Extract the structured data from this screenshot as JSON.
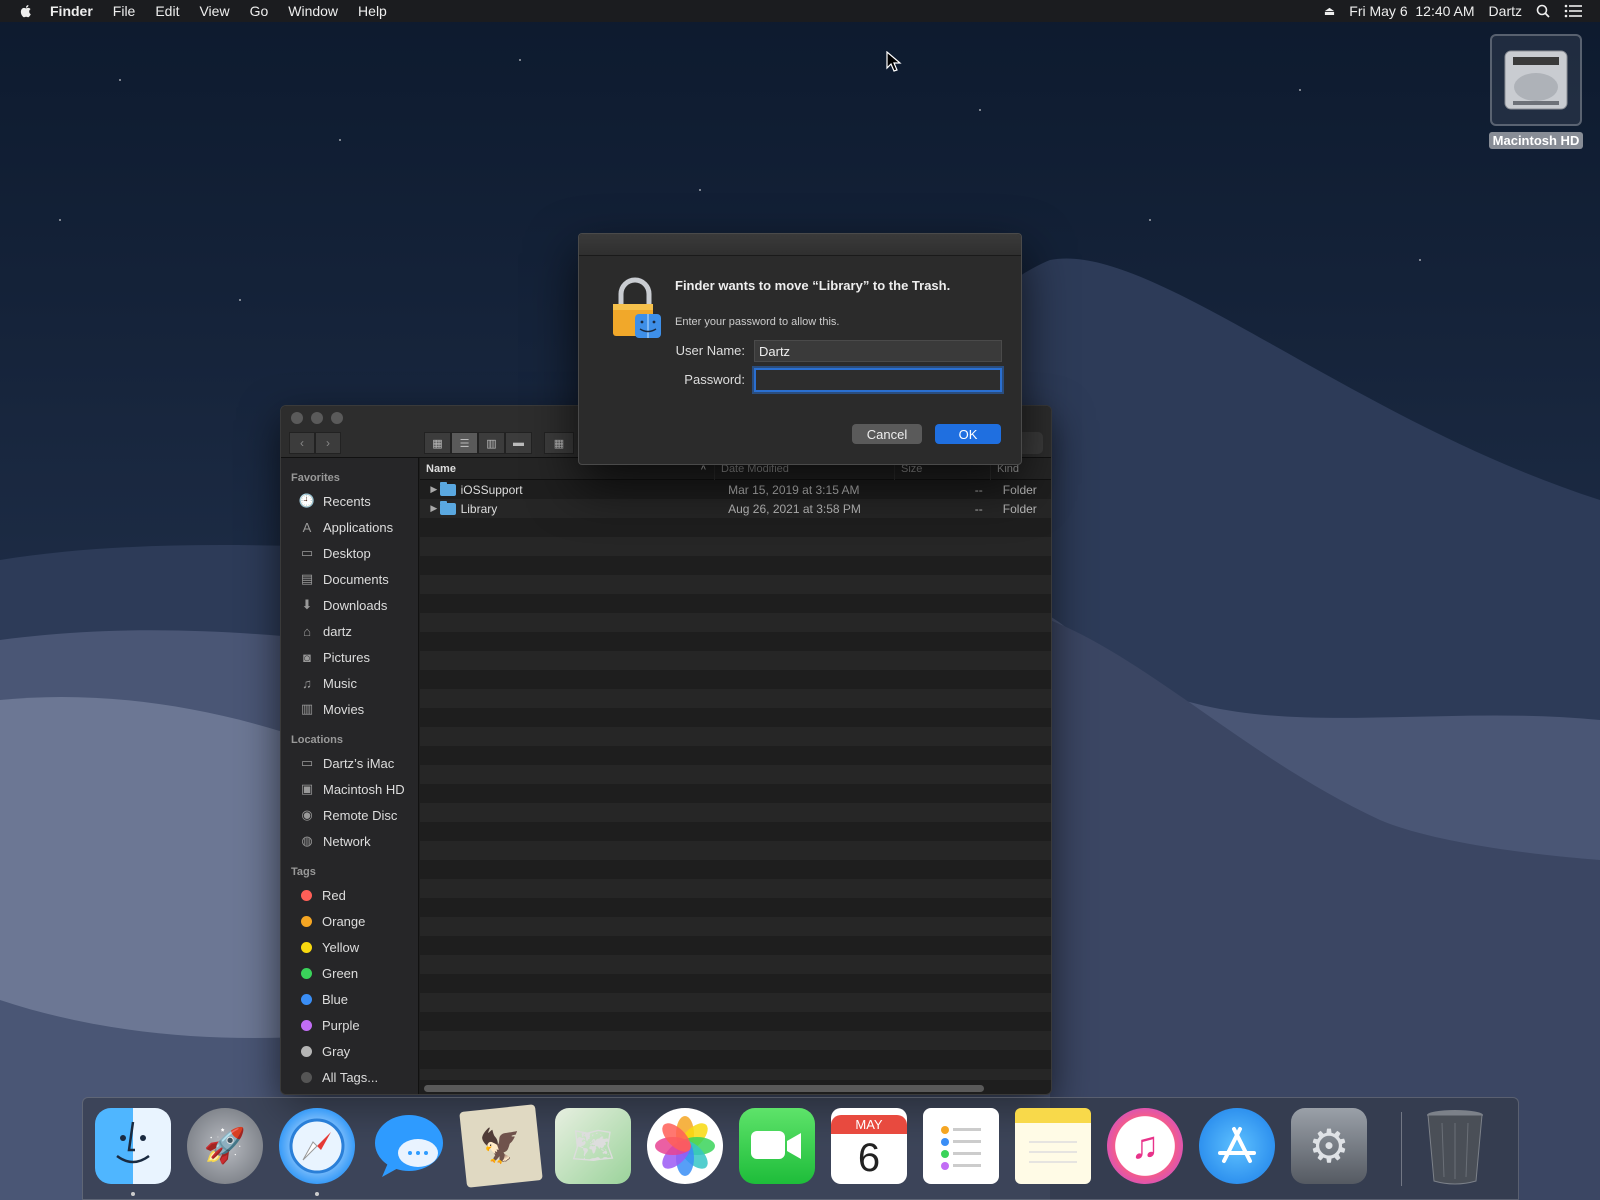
{
  "menubar": {
    "apple_icon": "apple-icon",
    "app_name": "Finder",
    "menus": [
      "File",
      "Edit",
      "View",
      "Go",
      "Window",
      "Help"
    ],
    "datetime": "Fri May 6  12:40 AM",
    "user": "Dartz"
  },
  "desktop": {
    "drive_label": "Macintosh HD"
  },
  "dialog": {
    "heading": "Finder wants to move “Library” to the Trash.",
    "subtext": "Enter your password to allow this.",
    "username_label": "User Name:",
    "username_value": "Dartz",
    "password_label": "Password:",
    "password_value": "",
    "cancel_label": "Cancel",
    "ok_label": "OK",
    "accent": "#1f6fe0"
  },
  "finder": {
    "sidebar": {
      "favorites_title": "Favorites",
      "favorites": [
        {
          "label": "Recents",
          "icon": "clock-icon"
        },
        {
          "label": "Applications",
          "icon": "applications-icon"
        },
        {
          "label": "Desktop",
          "icon": "desktop-icon"
        },
        {
          "label": "Documents",
          "icon": "document-icon"
        },
        {
          "label": "Downloads",
          "icon": "download-icon"
        },
        {
          "label": "dartz",
          "icon": "home-icon"
        },
        {
          "label": "Pictures",
          "icon": "camera-icon"
        },
        {
          "label": "Music",
          "icon": "music-icon"
        },
        {
          "label": "Movies",
          "icon": "film-icon"
        }
      ],
      "locations_title": "Locations",
      "locations": [
        {
          "label": "Dartz’s iMac",
          "icon": "computer-icon"
        },
        {
          "label": "Macintosh HD",
          "icon": "disk-icon"
        },
        {
          "label": "Remote Disc",
          "icon": "disc-icon"
        },
        {
          "label": "Network",
          "icon": "network-icon"
        }
      ],
      "tags_title": "Tags",
      "tags": [
        {
          "label": "Red",
          "color": "#ff5f57"
        },
        {
          "label": "Orange",
          "color": "#f5a623"
        },
        {
          "label": "Yellow",
          "color": "#f8d90f"
        },
        {
          "label": "Green",
          "color": "#3ad35a"
        },
        {
          "label": "Blue",
          "color": "#3a8ef6"
        },
        {
          "label": "Purple",
          "color": "#c26df5"
        },
        {
          "label": "Gray",
          "color": "#b5b5b5"
        },
        {
          "label": "All Tags...",
          "color": "#555555"
        }
      ]
    },
    "columns": {
      "name": "Name",
      "date": "Date Modified",
      "size": "Size",
      "kind": "Kind"
    },
    "files": [
      {
        "name": "iOSSupport",
        "date": "Mar 15, 2019 at 3:15 AM",
        "size": "--",
        "kind": "Folder"
      },
      {
        "name": "Library",
        "date": "Aug 26, 2021 at 3:58 PM",
        "size": "--",
        "kind": "Folder"
      }
    ]
  },
  "dock": {
    "calendar_month": "MAY",
    "calendar_day": "6"
  }
}
